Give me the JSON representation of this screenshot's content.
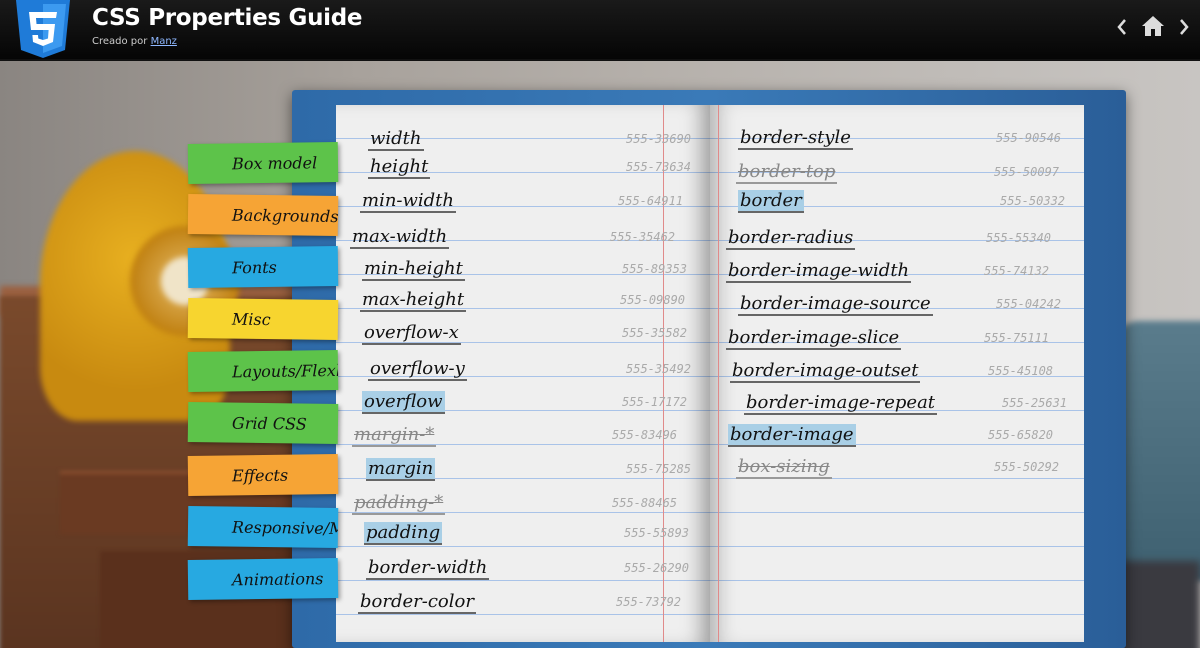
{
  "header": {
    "title": "CSS Properties Guide",
    "subtitle_prefix": "Creado por",
    "author": "Manz",
    "logo_icon": "css3-shield-icon",
    "nav": {
      "back_icon": "chevron-left-icon",
      "home_icon": "home-icon",
      "forward_icon": "chevron-right-icon"
    }
  },
  "tabs": [
    {
      "label": "Box model",
      "color": "#5dc34a"
    },
    {
      "label": "Backgrounds",
      "color": "#f6a435"
    },
    {
      "label": "Fonts",
      "color": "#27a9e1"
    },
    {
      "label": "Misc",
      "color": "#f7d52f"
    },
    {
      "label": "Layouts/Flexbox",
      "color": "#5dc34a"
    },
    {
      "label": "Grid CSS",
      "color": "#5dc34a"
    },
    {
      "label": "Effects",
      "color": "#f6a435"
    },
    {
      "label": "Responsive/Media",
      "color": "#27a9e1"
    },
    {
      "label": "Animations",
      "color": "#27a9e1"
    }
  ],
  "left_page": [
    {
      "name": "width",
      "code": "555-33690"
    },
    {
      "name": "height",
      "code": "555-73634"
    },
    {
      "name": "min-width",
      "code": "555-64911"
    },
    {
      "name": "max-width",
      "code": "555-35462"
    },
    {
      "name": "min-height",
      "code": "555-89353"
    },
    {
      "name": "max-height",
      "code": "555-09890"
    },
    {
      "name": "overflow-x",
      "code": "555-35582"
    },
    {
      "name": "overflow-y",
      "code": "555-35492"
    },
    {
      "name": "overflow",
      "code": "555-17172",
      "highlight": true
    },
    {
      "name": "margin-*",
      "code": "555-83496",
      "strike": true
    },
    {
      "name": "margin",
      "code": "555-75285",
      "highlight": true
    },
    {
      "name": "padding-*",
      "code": "555-88465",
      "strike": true
    },
    {
      "name": "padding",
      "code": "555-55893",
      "highlight": true
    },
    {
      "name": "border-width",
      "code": "555-26290"
    },
    {
      "name": "border-color",
      "code": "555-73792"
    }
  ],
  "right_page": [
    {
      "name": "border-style",
      "code": "555-90546"
    },
    {
      "name": "border-top",
      "code": "555-50097",
      "strike": true
    },
    {
      "name": "border",
      "code": "555-50332",
      "highlight": true
    },
    {
      "name": "border-radius",
      "code": "555-55340"
    },
    {
      "name": "border-image-width",
      "code": "555-74132"
    },
    {
      "name": "border-image-source",
      "code": "555-04242"
    },
    {
      "name": "border-image-slice",
      "code": "555-75111"
    },
    {
      "name": "border-image-outset",
      "code": "555-45108"
    },
    {
      "name": "border-image-repeat",
      "code": "555-25631"
    },
    {
      "name": "border-image",
      "code": "555-65820",
      "highlight": true
    },
    {
      "name": "box-sizing",
      "code": "555-50292",
      "strike": true
    }
  ]
}
